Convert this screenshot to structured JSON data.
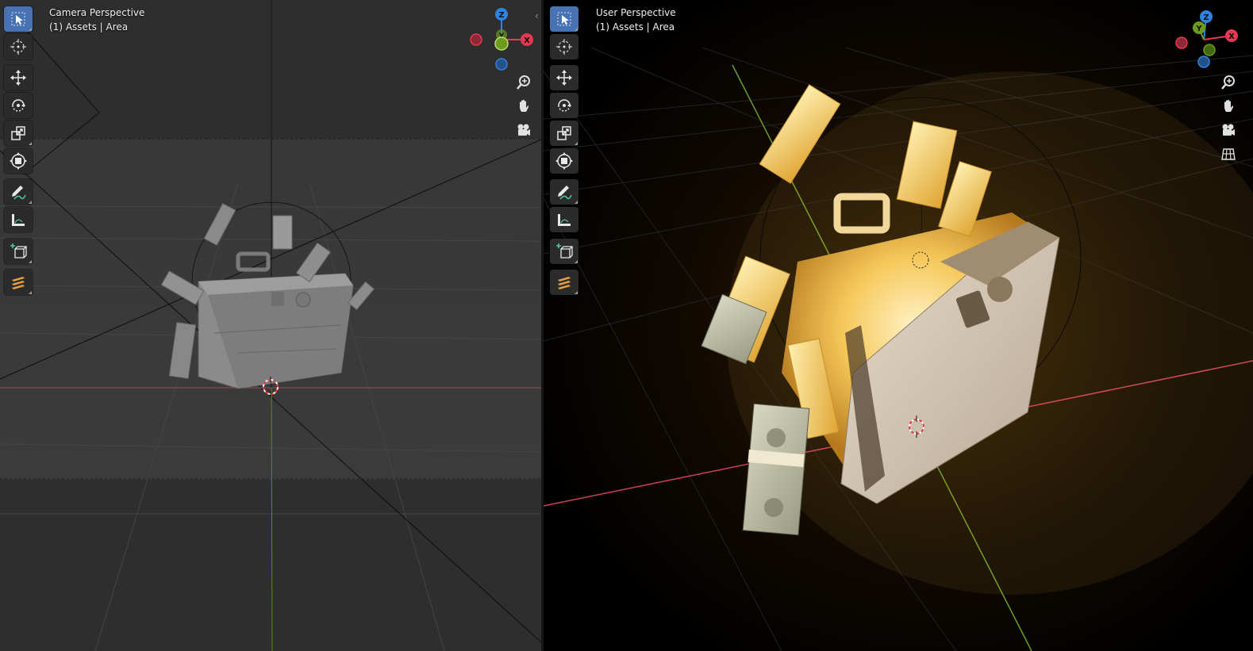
{
  "left_viewport": {
    "title": "Camera Perspective",
    "subtitle": "(1) Assets | Area",
    "axis_labels": {
      "z": "Z",
      "y": "Y",
      "x": "X"
    },
    "collapse_glyph": "‹",
    "nav_icons": [
      "zoom-icon",
      "hand-pan-icon",
      "camera-view-icon"
    ]
  },
  "right_viewport": {
    "title": "User Perspective",
    "subtitle": "(1) Assets | Area",
    "axis_labels": {
      "z": "Z",
      "y": "Y",
      "x": "X"
    },
    "collapse_glyph": "‹",
    "nav_icons": [
      "zoom-icon",
      "hand-pan-icon",
      "camera-view-icon",
      "ortho-grid-icon"
    ]
  },
  "tools": [
    "select-box-icon",
    "cursor-icon",
    "move-icon",
    "rotate-icon",
    "scale-icon",
    "transform-icon",
    "annotate-icon",
    "measure-icon",
    "add-cube-icon",
    "stripes-tool-icon"
  ],
  "colors": {
    "axis_x": "#e63952",
    "axis_y": "#6b9a1f",
    "axis_z": "#2f83e3",
    "active_tool": "#4772b3",
    "glow": "#f5b942"
  }
}
